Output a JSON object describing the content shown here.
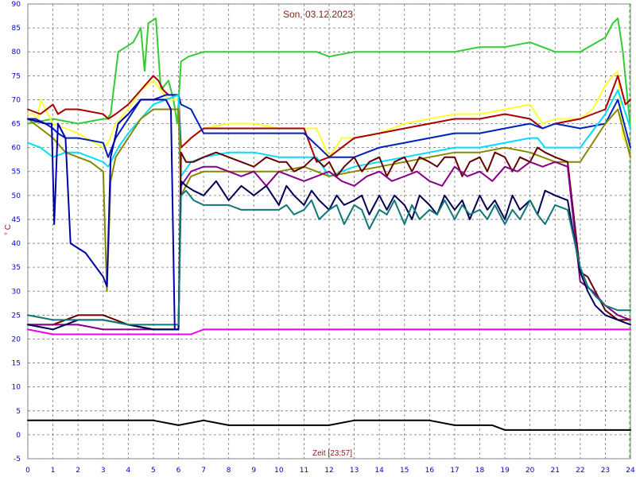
{
  "chart_data": {
    "type": "line",
    "title": "Son, 03.12.2023",
    "xlabel": "Zeit [23:57]",
    "ylabel": "° C",
    "xlim": [
      0,
      24
    ],
    "ylim": [
      -5,
      90
    ],
    "xticks": [
      0,
      1,
      2,
      3,
      4,
      5,
      6,
      7,
      8,
      9,
      10,
      11,
      12,
      13,
      14,
      15,
      16,
      17,
      18,
      19,
      20,
      21,
      22,
      23,
      24
    ],
    "yticks": [
      -5,
      0,
      5,
      10,
      15,
      20,
      25,
      30,
      35,
      40,
      45,
      50,
      55,
      60,
      65,
      70,
      75,
      80,
      85,
      90
    ],
    "grid": true,
    "background": "#ffffff",
    "series": [
      {
        "color": "#33cc33",
        "x": [
          0,
          1,
          2,
          3,
          3.15,
          3.3,
          3.6,
          4.2,
          4.5,
          4.65,
          4.8,
          5.1,
          5.3,
          5.6,
          5.8,
          5.95,
          6.1,
          6.4,
          7,
          8,
          10,
          11.5,
          12,
          13,
          15,
          17,
          18,
          19,
          20,
          20.5,
          21,
          21.5,
          22,
          23,
          23.3,
          23.5,
          23.7,
          24
        ],
        "values": [
          65,
          66,
          65,
          66,
          66,
          67,
          80,
          82,
          85,
          76,
          86,
          87,
          72,
          74,
          70,
          65,
          78,
          79,
          80,
          80,
          80,
          80,
          79,
          80,
          80,
          80,
          81,
          81,
          82,
          81,
          80,
          80,
          80,
          83,
          86,
          87,
          80,
          64
        ]
      },
      {
        "color": "#ffff33",
        "x": [
          0,
          0.2,
          0.4,
          0.5,
          1,
          2,
          3,
          3.2,
          3.5,
          4,
          4.5,
          5,
          5.3,
          5.6,
          6,
          6.1,
          6.5,
          7,
          8,
          9,
          10,
          11,
          11.5,
          12,
          12.5,
          13,
          14,
          15,
          16,
          17,
          18,
          19,
          20,
          20.5,
          21,
          21.5,
          22,
          22.5,
          23,
          23.3,
          23.5,
          23.7,
          24
        ],
        "values": [
          67,
          67,
          66,
          70,
          65,
          63,
          60,
          61,
          65,
          68,
          72,
          74,
          72,
          70,
          70,
          60,
          62,
          64,
          65,
          65,
          64,
          64,
          64,
          58,
          62,
          62,
          63,
          65,
          66,
          67,
          67,
          68,
          69,
          65,
          66,
          66,
          66,
          68,
          73,
          75,
          76,
          62,
          60
        ]
      },
      {
        "color": "#aa0000",
        "x": [
          0,
          0.5,
          1,
          1.2,
          1.5,
          2,
          3,
          3.2,
          3.5,
          4,
          4.5,
          5,
          5.2,
          5.4,
          5.6,
          6,
          6.1,
          6.5,
          7,
          8,
          9,
          10,
          11,
          11.5,
          12,
          13,
          14,
          15,
          16,
          17,
          18,
          19,
          20,
          20.5,
          21,
          22,
          23,
          23.5,
          23.8,
          24
        ],
        "values": [
          68,
          67,
          69,
          67,
          68,
          68,
          67,
          66,
          67,
          69,
          72,
          75,
          74,
          72,
          71,
          71,
          60,
          62,
          64,
          64,
          64,
          64,
          64,
          57,
          58,
          62,
          63,
          64,
          65,
          66,
          66,
          67,
          66,
          64,
          65,
          66,
          68,
          75,
          69,
          70
        ]
      },
      {
        "color": "#0022bb",
        "x": [
          0,
          0.3,
          0.7,
          1,
          1.2,
          1.5,
          2,
          3,
          3.2,
          3.5,
          4,
          4.5,
          5,
          5.5,
          6,
          6.1,
          6.5,
          7,
          8,
          9,
          10,
          11,
          12,
          13,
          14,
          15,
          16,
          17,
          18,
          19,
          20,
          20.5,
          21,
          22,
          23,
          23.5,
          24
        ],
        "values": [
          66,
          66,
          65,
          64,
          63,
          62,
          62,
          61,
          58,
          62,
          66,
          70,
          70,
          71,
          71,
          69,
          68,
          63,
          63,
          63,
          63,
          63,
          58,
          58,
          60,
          61,
          62,
          63,
          63,
          64,
          65,
          64,
          65,
          64,
          65,
          70,
          60
        ]
      },
      {
        "color": "#00ddff",
        "x": [
          0,
          0.5,
          1,
          1.5,
          2,
          3,
          3.2,
          3.6,
          4,
          4.5,
          5,
          5.5,
          6,
          6.1,
          6.5,
          7,
          8,
          9,
          10,
          11,
          11.5,
          12,
          13,
          14,
          15,
          16,
          17,
          18,
          19,
          20,
          20.3,
          20.6,
          21,
          21.5,
          22,
          23,
          23.5,
          24
        ],
        "values": [
          61,
          60,
          58,
          59,
          59,
          57,
          56,
          60,
          63,
          66,
          69,
          70,
          71,
          54,
          57,
          58,
          59,
          59,
          58,
          58,
          58,
          54,
          56,
          57,
          58,
          59,
          60,
          60,
          61,
          62,
          62,
          60,
          60,
          60,
          60,
          67,
          72,
          64
        ]
      },
      {
        "color": "#888800",
        "x": [
          0,
          0.5,
          1,
          1.5,
          2,
          2.5,
          3,
          3.15,
          3.3,
          3.5,
          4,
          4.5,
          5,
          5.5,
          6,
          6.1,
          6.5,
          7,
          8,
          9,
          10,
          11,
          12,
          13,
          14,
          15,
          16,
          17,
          18,
          19,
          20,
          21,
          22,
          23,
          23.5,
          24
        ],
        "values": [
          66,
          64,
          62,
          59,
          58,
          57,
          55,
          30,
          53,
          58,
          62,
          66,
          68,
          68,
          68,
          50,
          54,
          55,
          55,
          55,
          55,
          56,
          54,
          55,
          56,
          57,
          58,
          59,
          59,
          60,
          59,
          57,
          57,
          65,
          68,
          58
        ]
      },
      {
        "color": "#660000",
        "x": [
          0,
          1,
          2,
          3,
          4,
          5,
          5.6,
          5.8,
          6,
          6.1,
          6.3,
          6.6,
          7,
          7.5,
          8,
          8.5,
          9,
          9.5,
          10,
          10.3,
          10.6,
          11,
          11.4,
          11.8,
          12,
          12.3,
          12.6,
          13,
          13.3,
          13.6,
          14,
          14.3,
          14.6,
          15,
          15.3,
          15.6,
          16,
          16.3,
          16.6,
          17,
          17.3,
          17.6,
          18,
          18.3,
          18.6,
          19,
          19.3,
          19.6,
          20,
          20.3,
          20.6,
          21,
          21.5,
          22,
          22.3,
          22.6,
          23,
          23.5,
          24
        ],
        "values": [
          23,
          23,
          25,
          25,
          23,
          22,
          22,
          22,
          22,
          59,
          57,
          57,
          58,
          59,
          58,
          57,
          56,
          58,
          57,
          57,
          55,
          56,
          58,
          56,
          57,
          54,
          56,
          58,
          55,
          57,
          58,
          54,
          57,
          58,
          55,
          58,
          57,
          56,
          58,
          58,
          54,
          57,
          58,
          55,
          59,
          58,
          55,
          58,
          57,
          60,
          59,
          58,
          57,
          34,
          33,
          30,
          26,
          24,
          24
        ]
      },
      {
        "color": "#880088",
        "x": [
          0,
          1,
          2,
          3,
          4,
          5,
          5.6,
          5.8,
          6,
          6.1,
          6.5,
          7,
          7.5,
          8,
          8.5,
          9,
          9.5,
          10,
          10.5,
          11,
          11.5,
          12,
          12.5,
          13,
          13.5,
          14,
          14.5,
          15,
          15.5,
          16,
          16.5,
          17,
          17.5,
          18,
          18.5,
          19,
          19.5,
          20,
          20.5,
          21,
          21.5,
          22,
          22.5,
          23,
          23.5,
          24
        ],
        "values": [
          23,
          23,
          23,
          22,
          22,
          22,
          22,
          22,
          22,
          52,
          55,
          56,
          56,
          55,
          54,
          55,
          52,
          55,
          54,
          53,
          54,
          55,
          53,
          52,
          54,
          55,
          53,
          54,
          55,
          53,
          52,
          56,
          54,
          55,
          53,
          56,
          55,
          57,
          56,
          57,
          56,
          32,
          30,
          27,
          25,
          24
        ]
      },
      {
        "color": "#000055",
        "x": [
          0,
          1,
          2,
          3,
          4,
          5,
          5.6,
          5.8,
          6,
          6.1,
          6.3,
          6.6,
          7,
          7.5,
          8,
          8.5,
          9,
          9.5,
          10,
          10.3,
          10.6,
          11,
          11.3,
          11.6,
          12,
          12.3,
          12.6,
          13,
          13.3,
          13.6,
          14,
          14.3,
          14.6,
          15,
          15.3,
          15.6,
          16,
          16.3,
          16.6,
          17,
          17.3,
          17.6,
          18,
          18.3,
          18.6,
          19,
          19.3,
          19.6,
          20,
          20.3,
          20.6,
          21,
          21.5,
          22,
          22.3,
          22.6,
          23,
          23.5,
          24
        ],
        "values": [
          23,
          22,
          24,
          24,
          23,
          22,
          22,
          22,
          22,
          53,
          52,
          51,
          50,
          53,
          49,
          52,
          50,
          52,
          48,
          52,
          50,
          48,
          51,
          49,
          47,
          50,
          48,
          49,
          50,
          46,
          50,
          47,
          50,
          48,
          45,
          50,
          48,
          46,
          50,
          47,
          49,
          45,
          50,
          47,
          49,
          45,
          50,
          47,
          49,
          46,
          51,
          50,
          49,
          34,
          30,
          27,
          25,
          24,
          23
        ]
      },
      {
        "color": "#117777",
        "x": [
          0,
          1,
          2,
          3,
          4,
          5,
          5.6,
          5.8,
          6,
          6.1,
          6.3,
          6.6,
          7,
          7.5,
          8,
          8.5,
          9,
          9.5,
          10,
          10.3,
          10.6,
          11,
          11.3,
          11.6,
          12,
          12.3,
          12.6,
          13,
          13.3,
          13.6,
          14,
          14.3,
          14.6,
          15,
          15.3,
          15.6,
          16,
          16.3,
          16.6,
          17,
          17.3,
          17.6,
          18,
          18.3,
          18.6,
          19,
          19.3,
          19.6,
          20,
          20.3,
          20.6,
          21,
          21.5,
          22,
          22.3,
          22.6,
          23,
          23.5,
          24
        ],
        "values": [
          25,
          24,
          24,
          24,
          23,
          23,
          23,
          23,
          23,
          50,
          51,
          49,
          48,
          48,
          48,
          47,
          47,
          47,
          47,
          48,
          46,
          47,
          49,
          45,
          47,
          48,
          44,
          48,
          47,
          43,
          47,
          46,
          49,
          44,
          48,
          45,
          47,
          46,
          49,
          45,
          48,
          46,
          47,
          45,
          48,
          44,
          47,
          45,
          49,
          46,
          44,
          48,
          47,
          35,
          31,
          29,
          27,
          26,
          26
        ]
      },
      {
        "color": "#0000aa",
        "x": [
          0,
          0.7,
          0.95,
          1.05,
          1.2,
          1.5,
          1.7,
          2.3,
          3,
          3.15,
          3.3,
          3.6,
          4,
          4.5,
          5,
          5.5,
          5.7,
          5.85,
          6
        ],
        "values": [
          66,
          65,
          65,
          44,
          65,
          62,
          40,
          38,
          33,
          31,
          58,
          65,
          67,
          70,
          70,
          70,
          68,
          22,
          22
        ]
      },
      {
        "color": "#ee00ee",
        "x": [
          0,
          1,
          2,
          3,
          4,
          5,
          5.8,
          6,
          6.5,
          7,
          8,
          10,
          12,
          14,
          16,
          18,
          20,
          22,
          23,
          24
        ],
        "values": [
          22,
          21,
          21,
          21,
          21,
          21,
          21,
          21,
          21,
          22,
          22,
          22,
          22,
          22,
          22,
          22,
          22,
          22,
          22,
          22
        ]
      },
      {
        "color": "#000000",
        "x": [
          0,
          1,
          2,
          3,
          4,
          5,
          6,
          7,
          8,
          9,
          10,
          11,
          12,
          13,
          14,
          15,
          16,
          17,
          18,
          18.5,
          19,
          20,
          21,
          22,
          23,
          24
        ],
        "values": [
          3,
          3,
          3,
          3,
          3,
          3,
          2,
          3,
          2,
          2,
          2,
          2,
          2,
          3,
          3,
          3,
          3,
          2,
          2,
          2,
          1,
          1,
          1,
          1,
          1,
          1
        ]
      }
    ]
  }
}
